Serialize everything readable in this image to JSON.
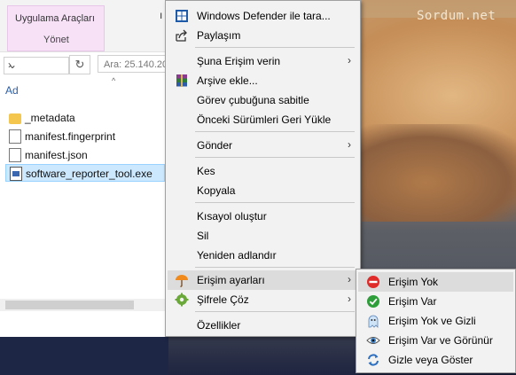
{
  "watermark": "Sordum.net",
  "explorer": {
    "ribbon_context_tab": "Uygulama Araçları",
    "ribbon_context_sub": "Yönet",
    "ribbon_more": "ı",
    "search_placeholder": "Ara: 25.140.20",
    "refresh_glyph": "↻",
    "column_header": "Ad",
    "files": [
      {
        "name": "_metadata",
        "type": "folder"
      },
      {
        "name": "manifest.fingerprint",
        "type": "file"
      },
      {
        "name": "manifest.json",
        "type": "file"
      },
      {
        "name": "software_reporter_tool.exe",
        "type": "exe",
        "selected": true
      }
    ]
  },
  "context_menu": {
    "items": [
      {
        "label": "Windows Defender ile tara...",
        "icon": "defender-icon"
      },
      {
        "label": "Paylaşım",
        "icon": "share-icon"
      },
      {
        "label": "Şuna Erişim verin",
        "submenu": true
      },
      {
        "label": "Arşive ekle...",
        "icon": "winrar-icon"
      },
      {
        "label": "Görev çubuğuna sabitle"
      },
      {
        "label": "Önceki Sürümleri Geri Yükle"
      },
      {
        "label": "Gönder",
        "submenu": true
      },
      {
        "label": "Kes"
      },
      {
        "label": "Kopyala"
      },
      {
        "label": "Kısayol oluştur"
      },
      {
        "label": "Sil"
      },
      {
        "label": "Yeniden adlandır"
      },
      {
        "label": "Erişim ayarları",
        "icon": "umbrella-icon",
        "submenu": true,
        "highlighted": true
      },
      {
        "label": "Şifrele  Çöz",
        "icon": "gear-icon",
        "submenu": true
      },
      {
        "label": "Özellikler"
      }
    ]
  },
  "submenu": {
    "items": [
      {
        "label": "Erişim Yok",
        "icon": "no-entry-icon",
        "highlighted": true
      },
      {
        "label": "Erişim Var",
        "icon": "check-icon"
      },
      {
        "label": "Erişim Yok ve Gizli",
        "icon": "ghost-icon"
      },
      {
        "label": "Erişim Var ve Görünür",
        "icon": "eye-icon"
      },
      {
        "label": "Gizle veya Göster",
        "icon": "refresh-icon"
      }
    ]
  },
  "colors": {
    "context_tab_bg": "#f6e1f7",
    "selection_bg": "#cce8ff",
    "menu_bg": "#f2f2f2",
    "menu_highlight": "#dcdcdc"
  }
}
